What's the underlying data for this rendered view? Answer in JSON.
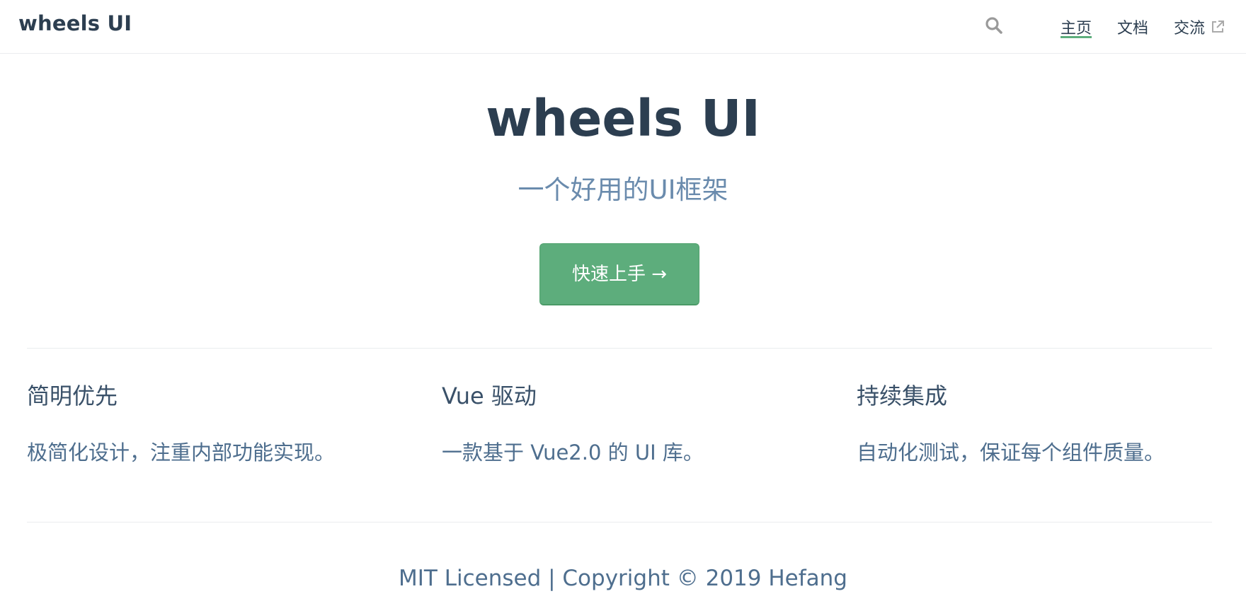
{
  "navbar": {
    "site_name": "wheels UI",
    "search_icon": "search-icon",
    "items": [
      {
        "label": "主页",
        "active": true
      },
      {
        "label": "文档",
        "active": false
      },
      {
        "label": "交流",
        "active": false,
        "external": true
      }
    ]
  },
  "hero": {
    "title": "wheels UI",
    "description": "一个好用的UI框架",
    "action_label": "快速上手 →"
  },
  "features": [
    {
      "title": "简明优先",
      "details": "极简化设计，注重内部功能实现。"
    },
    {
      "title": "Vue 驱动",
      "details": "一款基于 Vue2.0 的 UI 库。"
    },
    {
      "title": "持续集成",
      "details": "自动化测试，保证每个组件质量。"
    }
  ],
  "footer": {
    "text": "MIT Licensed | Copyright © 2019 Hefang"
  },
  "colors": {
    "accent": "#5dad7c",
    "text": "#2c3e50",
    "muted": "#6a8bad",
    "border": "#eaecef"
  }
}
